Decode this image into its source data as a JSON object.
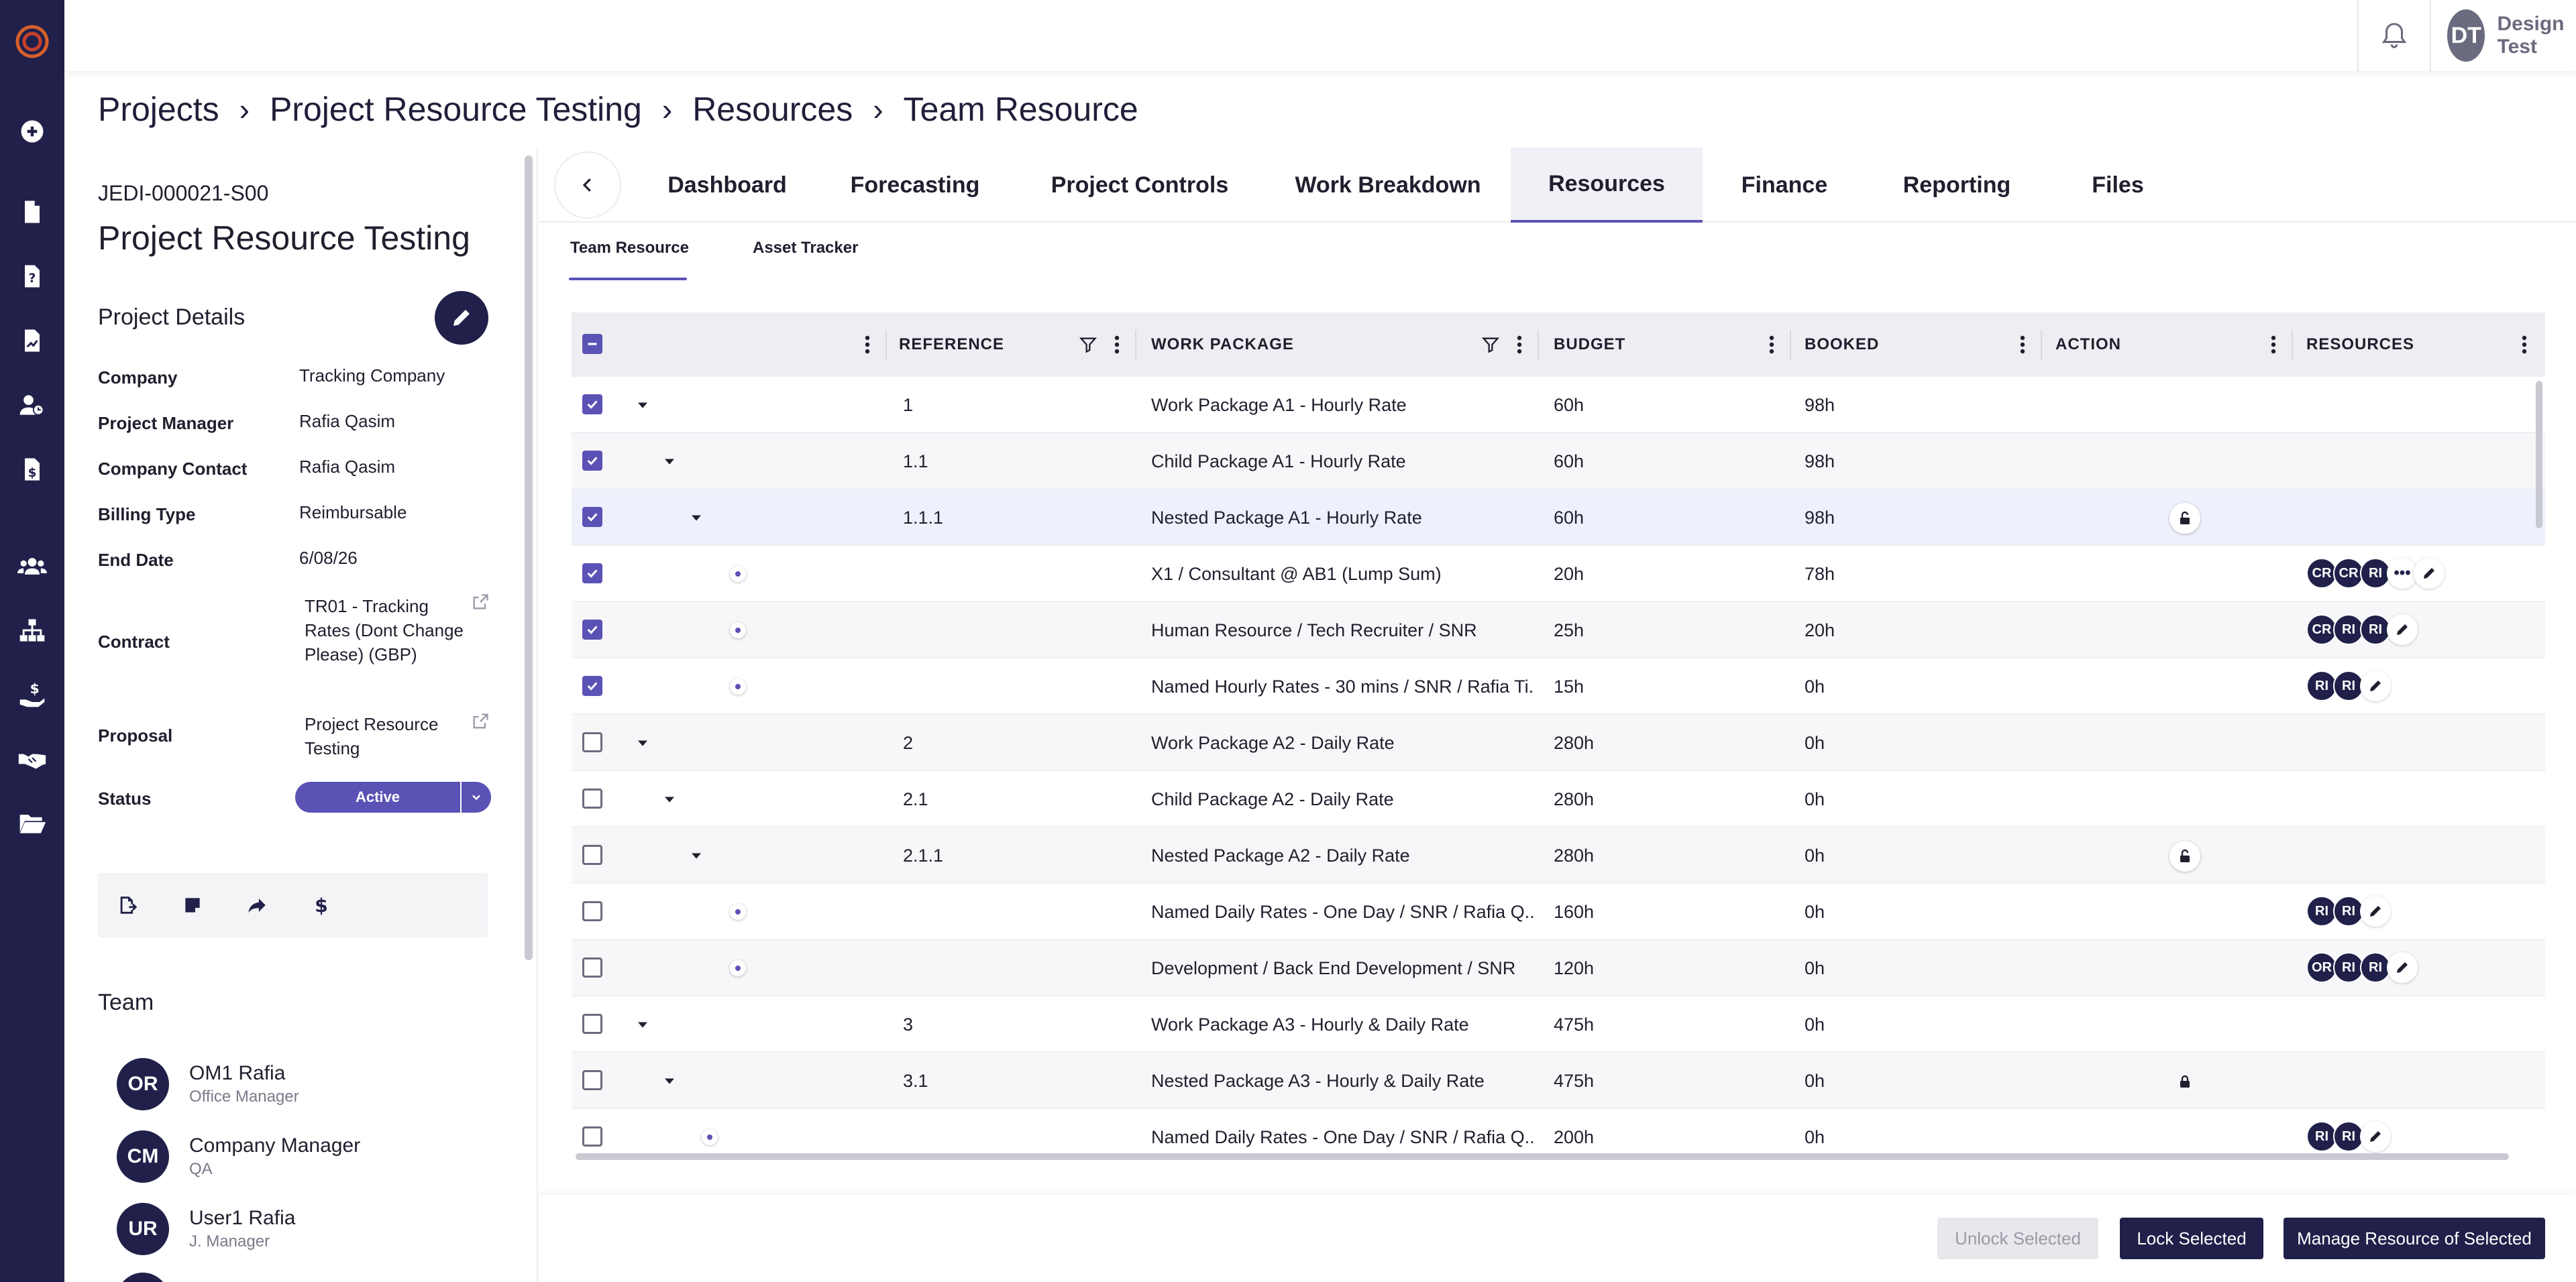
{
  "user": {
    "initials": "DT",
    "name": "Design Test"
  },
  "breadcrumb": [
    "Projects",
    "Project Resource Testing",
    "Resources",
    "Team Resource"
  ],
  "project": {
    "code": "JEDI-000021-S00",
    "name": "Project Resource Testing",
    "details_title": "Project Details",
    "fields": {
      "company_label": "Company",
      "company": "Tracking Company",
      "pm_label": "Project Manager",
      "pm": "Rafia Qasim",
      "contact_label": "Company Contact",
      "contact": "Rafia Qasim",
      "billing_label": "Billing Type",
      "billing": "Reimbursable",
      "end_label": "End Date",
      "end": "6/08/26",
      "contract_label": "Contract",
      "contract": "TR01 - Tracking Rates (Dont Change Please) (GBP)",
      "proposal_label": "Proposal",
      "proposal": "Project Resource Testing",
      "status_label": "Status",
      "status": "Active"
    },
    "team_title": "Team",
    "team": [
      {
        "initials": "OR",
        "name": "OM1 Rafia",
        "role": "Office Manager"
      },
      {
        "initials": "CM",
        "name": "Company Manager",
        "role": "QA"
      },
      {
        "initials": "UR",
        "name": "User1 Rafia",
        "role": "J. Manager"
      }
    ]
  },
  "tabs": [
    "Dashboard",
    "Forecasting",
    "Project Controls",
    "Work Breakdown",
    "Resources",
    "Finance",
    "Reporting",
    "Files"
  ],
  "active_tab": "Resources",
  "subtabs": [
    "Team Resource",
    "Asset Tracker"
  ],
  "table": {
    "columns": {
      "reference": "REFERENCE",
      "work_package": "WORK PACKAGE",
      "budget": "BUDGET",
      "booked": "BOOKED",
      "action": "ACTION",
      "resources": "RESOURCES"
    },
    "rows": [
      {
        "checked": true,
        "ref": "1",
        "wp": "Work Package A1 - Hourly Rate",
        "budget": "60h",
        "booked": "98h"
      },
      {
        "checked": true,
        "ref": "1.1",
        "wp": "Child Package A1 - Hourly Rate",
        "budget": "60h",
        "booked": "98h"
      },
      {
        "checked": true,
        "ref": "1.1.1",
        "wp": "Nested Package A1 - Hourly Rate",
        "budget": "60h",
        "booked": "98h",
        "lock": "unlocked"
      },
      {
        "checked": true,
        "ref": "",
        "wp": "X1 / Consultant @ AB1 (Lump Sum)",
        "budget": "20h",
        "booked": "78h",
        "chips": [
          "CR",
          "CR",
          "RI"
        ],
        "more": "•••"
      },
      {
        "checked": true,
        "ref": "",
        "wp": "Human Resource / Tech Recruiter / SNR",
        "budget": "25h",
        "booked": "20h",
        "chips": [
          "CR",
          "RI",
          "RI"
        ]
      },
      {
        "checked": true,
        "ref": "",
        "wp": "Named Hourly Rates - 30 mins / SNR / Rafia Ti...",
        "budget": "15h",
        "booked": "0h",
        "chips": [
          "RI",
          "RI"
        ]
      },
      {
        "checked": false,
        "ref": "2",
        "wp": "Work Package A2 - Daily Rate",
        "budget": "280h",
        "booked": "0h"
      },
      {
        "checked": false,
        "ref": "2.1",
        "wp": "Child Package A2 - Daily Rate",
        "budget": "280h",
        "booked": "0h"
      },
      {
        "checked": false,
        "ref": "2.1.1",
        "wp": "Nested Package A2 - Daily Rate",
        "budget": "280h",
        "booked": "0h",
        "lock": "unlocked"
      },
      {
        "checked": false,
        "ref": "",
        "wp": "Named Daily Rates - One Day / SNR / Rafia Q...",
        "budget": "160h",
        "booked": "0h",
        "chips": [
          "RI",
          "RI"
        ]
      },
      {
        "checked": false,
        "ref": "",
        "wp": "Development / Back End Development / SNR",
        "budget": "120h",
        "booked": "0h",
        "chips": [
          "OR",
          "RI",
          "RI"
        ]
      },
      {
        "checked": false,
        "ref": "3",
        "wp": "Work Package A3 - Hourly & Daily Rate",
        "budget": "475h",
        "booked": "0h"
      },
      {
        "checked": false,
        "ref": "3.1",
        "wp": "Nested Package A3 - Hourly & Daily Rate",
        "budget": "475h",
        "booked": "0h",
        "lock": "locked"
      },
      {
        "checked": false,
        "ref": "",
        "wp": "Named Daily Rates - One Day / SNR / Rafia Q...",
        "budget": "200h",
        "booked": "0h",
        "chips": [
          "RI",
          "RI"
        ]
      }
    ]
  },
  "footer": {
    "unlock": "Unlock Selected",
    "lock": "Lock Selected",
    "manage": "Manage Resource of Selected"
  },
  "colors": {
    "navy": "#20204a",
    "accent": "#5b52b5"
  }
}
